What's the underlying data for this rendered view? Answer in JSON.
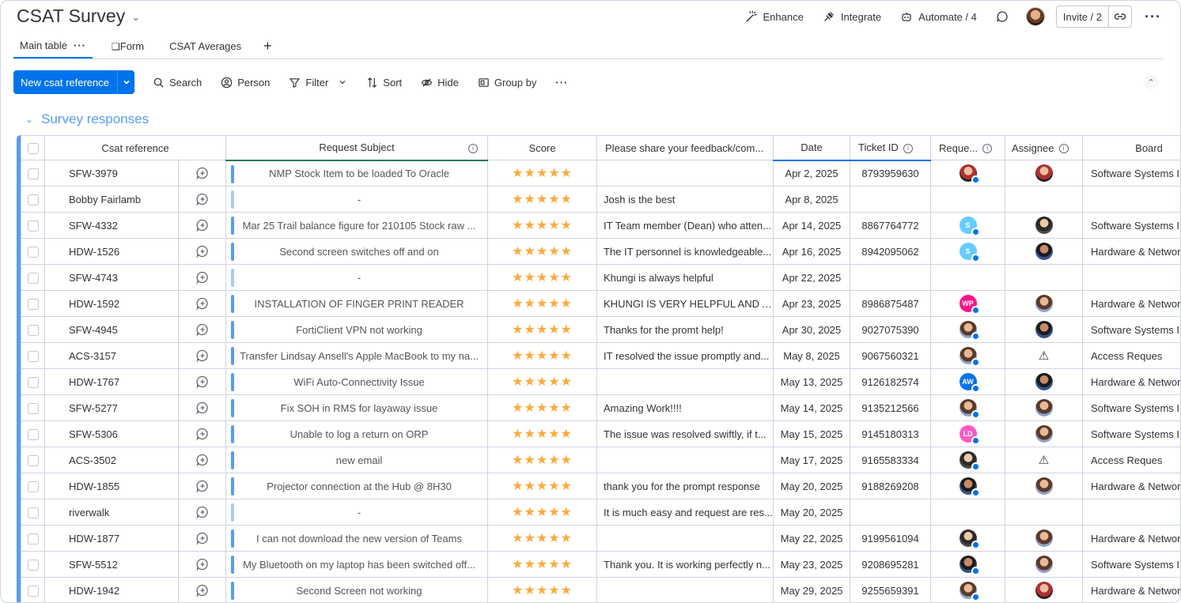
{
  "board": {
    "title": "CSAT Survey"
  },
  "header": {
    "enhance": "Enhance",
    "integrate": "Integrate",
    "automate": "Automate / 4",
    "invite": "Invite / 2"
  },
  "tabs": [
    {
      "label": "Main table"
    },
    {
      "label": "Form"
    },
    {
      "label": "CSAT Averages"
    }
  ],
  "toolbar": {
    "new_item": "New csat reference",
    "search": "Search",
    "person": "Person",
    "filter": "Filter",
    "sort": "Sort",
    "hide": "Hide",
    "group_by": "Group by"
  },
  "group": {
    "title": "Survey responses"
  },
  "columns": {
    "ref": "Csat reference",
    "subject": "Request Subject",
    "score": "Score",
    "feedback": "Please share your feedback/com...",
    "date": "Date",
    "ticket": "Ticket ID",
    "requester": "Reque...",
    "assignee": "Assignee",
    "board": "Board"
  },
  "colors": {
    "accent": "#0073ea",
    "group": "#579bfc",
    "star": "#fdab3d"
  },
  "rows": [
    {
      "ref": "SFW-3979",
      "subject": "NMP Stock Item to be loaded To Oracle",
      "stars": "★★★★★",
      "feedback": "",
      "date": "Apr 2, 2025",
      "ticket": "8793959630",
      "requester": {
        "type": "photo",
        "cls": "av-red",
        "initials": ""
      },
      "assignee": {
        "type": "photo",
        "cls": "av-red",
        "initials": ""
      },
      "board": "Software Systems I"
    },
    {
      "ref": "Bobby Fairlamb",
      "subject": "-",
      "stars": "★★★★★",
      "feedback": "Josh is the best",
      "date": "Apr 8, 2025",
      "ticket": "",
      "requester": null,
      "assignee": null,
      "board": ""
    },
    {
      "ref": "SFW-4332",
      "subject": "Mar 25 Trail balance figure for 210105 Stock raw ...",
      "stars": "★★★★★",
      "feedback": "IT Team member (Dean) who atten...",
      "date": "Apr 14, 2025",
      "ticket": "8867764772",
      "requester": {
        "type": "initials",
        "cls": "av-s",
        "initials": "S"
      },
      "assignee": {
        "type": "photo",
        "cls": "av-photo2",
        "initials": ""
      },
      "board": "Software Systems I"
    },
    {
      "ref": "HDW-1526",
      "subject": "Second screen switches off and on",
      "stars": "★★★★★",
      "feedback": "The IT personnel is knowledgeable...",
      "date": "Apr 16, 2025",
      "ticket": "8942095062",
      "requester": {
        "type": "initials",
        "cls": "av-s",
        "initials": "S"
      },
      "assignee": {
        "type": "photo",
        "cls": "av-photo3",
        "initials": ""
      },
      "board": "Hardware & Networ"
    },
    {
      "ref": "SFW-4743",
      "subject": "-",
      "stars": "★★★★★",
      "feedback": "Khungi is always helpful",
      "date": "Apr 22, 2025",
      "ticket": "",
      "requester": null,
      "assignee": null,
      "board": ""
    },
    {
      "ref": "HDW-1592",
      "subject": "INSTALLATION OF FINGER PRINT READER",
      "stars": "★★★★★",
      "feedback": "KHUNGI IS VERY HELPFUL AND A...",
      "date": "Apr 23, 2025",
      "ticket": "8986875487",
      "requester": {
        "type": "initials",
        "cls": "av-wp",
        "initials": "WP"
      },
      "assignee": {
        "type": "photo",
        "cls": "av-photo",
        "initials": ""
      },
      "board": "Hardware & Networ"
    },
    {
      "ref": "SFW-4945",
      "subject": "FortiClient VPN not working",
      "stars": "★★★★★",
      "feedback": "Thanks for the promt help!",
      "date": "Apr 30, 2025",
      "ticket": "9027075390",
      "requester": {
        "type": "photo",
        "cls": "av-photo",
        "initials": ""
      },
      "assignee": {
        "type": "photo",
        "cls": "av-photo3",
        "initials": ""
      },
      "board": "Software Systems I"
    },
    {
      "ref": "ACS-3157",
      "subject": "Transfer Lindsay Ansell's Apple MacBook to my na...",
      "stars": "★★★★★",
      "feedback": "IT resolved the issue promptly and...",
      "date": "May 8, 2025",
      "ticket": "9067560321",
      "requester": {
        "type": "photo",
        "cls": "av-photo",
        "initials": ""
      },
      "assignee": {
        "type": "warn",
        "cls": "",
        "initials": ""
      },
      "board": "Access Reques"
    },
    {
      "ref": "HDW-1767",
      "subject": "WiFi Auto-Connectivity Issue",
      "stars": "★★★★★",
      "feedback": "",
      "date": "May 13, 2025",
      "ticket": "9126182574",
      "requester": {
        "type": "initials",
        "cls": "av-aw",
        "initials": "AW"
      },
      "assignee": {
        "type": "photo",
        "cls": "av-photo3",
        "initials": ""
      },
      "board": "Hardware & Networ"
    },
    {
      "ref": "SFW-5277",
      "subject": "Fix SOH in RMS for layaway issue",
      "stars": "★★★★★",
      "feedback": "Amazing Work!!!!",
      "date": "May 14, 2025",
      "ticket": "9135212566",
      "requester": {
        "type": "photo",
        "cls": "av-photo",
        "initials": ""
      },
      "assignee": {
        "type": "photo",
        "cls": "av-photo",
        "initials": ""
      },
      "board": "Software Systems I"
    },
    {
      "ref": "SFW-5306",
      "subject": "Unable to log a return on ORP",
      "stars": "★★★★★",
      "feedback": "The issue was resolved swiftly, if t...",
      "date": "May 15, 2025",
      "ticket": "9145180313",
      "requester": {
        "type": "initials",
        "cls": "av-ld",
        "initials": "LD"
      },
      "assignee": {
        "type": "photo",
        "cls": "av-photo",
        "initials": ""
      },
      "board": "Software Systems I"
    },
    {
      "ref": "ACS-3502",
      "subject": "new email",
      "stars": "★★★★★",
      "feedback": "",
      "date": "May 17, 2025",
      "ticket": "9165583334",
      "requester": {
        "type": "photo",
        "cls": "av-photo2",
        "initials": ""
      },
      "assignee": {
        "type": "warn",
        "cls": "",
        "initials": ""
      },
      "board": "Access Reques"
    },
    {
      "ref": "HDW-1855",
      "subject": "Projector connection at the Hub @ 8H30",
      "stars": "★★★★★",
      "feedback": "thank you for the prompt response",
      "date": "May 20, 2025",
      "ticket": "9188269208",
      "requester": {
        "type": "photo",
        "cls": "av-photo3",
        "initials": ""
      },
      "assignee": {
        "type": "photo",
        "cls": "av-photo",
        "initials": ""
      },
      "board": "Hardware & Networ"
    },
    {
      "ref": "riverwalk",
      "subject": "-",
      "stars": "★★★★★",
      "feedback": "It is much easy and request are res...",
      "date": "May 20, 2025",
      "ticket": "",
      "requester": null,
      "assignee": null,
      "board": ""
    },
    {
      "ref": "HDW-1877",
      "subject": "I can not download the new version of Teams",
      "stars": "★★★★★",
      "feedback": "",
      "date": "May 22, 2025",
      "ticket": "9199561094",
      "requester": {
        "type": "photo",
        "cls": "av-photo2",
        "initials": ""
      },
      "assignee": {
        "type": "photo",
        "cls": "av-photo",
        "initials": ""
      },
      "board": "Hardware & Networ"
    },
    {
      "ref": "SFW-5512",
      "subject": "My Bluetooth on my laptop has been switched off...",
      "stars": "★★★★★",
      "feedback": "Thank you. It is working perfectly n...",
      "date": "May 23, 2025",
      "ticket": "9208695281",
      "requester": {
        "type": "photo",
        "cls": "av-photo3",
        "initials": ""
      },
      "assignee": {
        "type": "photo",
        "cls": "av-photo",
        "initials": ""
      },
      "board": "Software Systems I"
    },
    {
      "ref": "HDW-1942",
      "subject": "Second Screen not working",
      "stars": "★★★★★",
      "feedback": "",
      "date": "May 29, 2025",
      "ticket": "9255659391",
      "requester": {
        "type": "photo",
        "cls": "av-photo",
        "initials": ""
      },
      "assignee": {
        "type": "photo",
        "cls": "av-red",
        "initials": ""
      },
      "board": "Hardware & Networ"
    }
  ]
}
